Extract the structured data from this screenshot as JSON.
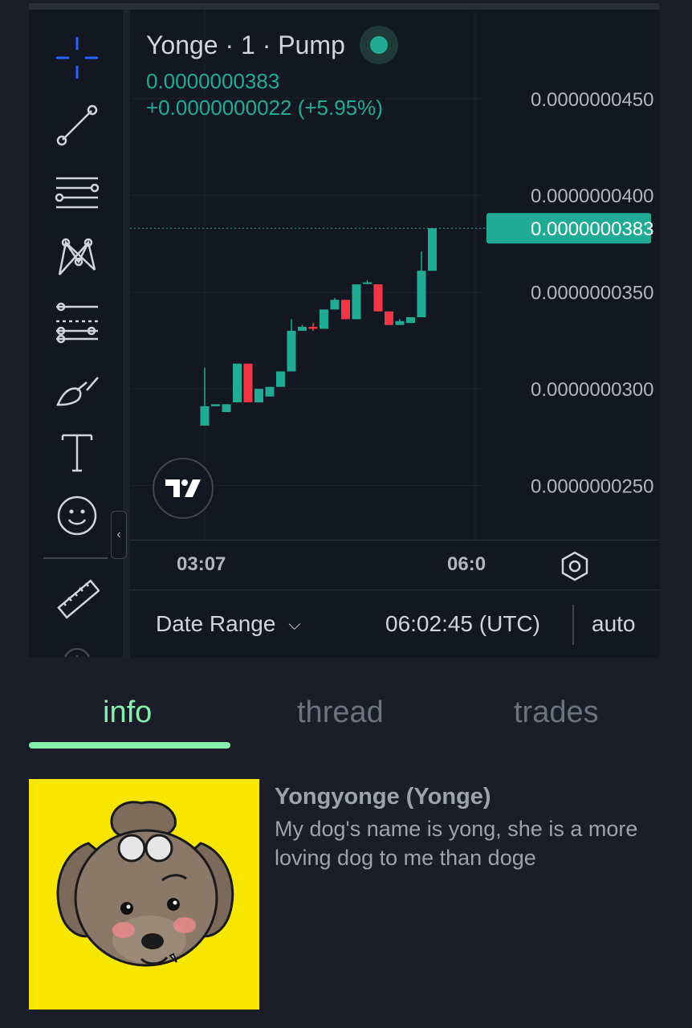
{
  "chart": {
    "title": "Yonge · 1 · Pump",
    "price": "0.0000000383",
    "change": "+0.0000000022 (+5.95%)",
    "current_price_label": "0.0000000383",
    "price_axis_labels": [
      "0.0000000450",
      "0.0000000400",
      "0.0000000350",
      "0.0000000300",
      "0.0000000250"
    ],
    "time_labels": [
      "03:07",
      "06:0"
    ],
    "colors": {
      "up": "#22ab94",
      "down": "#f23645",
      "background": "#131722"
    }
  },
  "chart_data": {
    "type": "candlestick",
    "title": "Yonge · 1 · Pump",
    "ylim": [
      2.22e-08,
      4.96e-08
    ],
    "price_ticks": [
      4.5e-08,
      4e-08,
      3.5e-08,
      3e-08,
      2.5e-08
    ],
    "x_ticks": [
      "03:07",
      "06:0"
    ],
    "last_price": 3.83e-08,
    "candles": [
      {
        "open": 2.81e-08,
        "high": 3.11e-08,
        "low": 2.81e-08,
        "close": 2.91e-08
      },
      {
        "open": 2.91e-08,
        "high": 2.92e-08,
        "low": 2.91e-08,
        "close": 2.92e-08
      },
      {
        "open": 2.88e-08,
        "high": 2.92e-08,
        "low": 2.88e-08,
        "close": 2.92e-08
      },
      {
        "open": 2.93e-08,
        "high": 3.13e-08,
        "low": 2.93e-08,
        "close": 3.13e-08
      },
      {
        "open": 3.13e-08,
        "high": 3.13e-08,
        "low": 2.93e-08,
        "close": 2.93e-08
      },
      {
        "open": 2.93e-08,
        "high": 3e-08,
        "low": 2.93e-08,
        "close": 3e-08
      },
      {
        "open": 2.96e-08,
        "high": 3.01e-08,
        "low": 2.96e-08,
        "close": 3.01e-08
      },
      {
        "open": 3.01e-08,
        "high": 3.09e-08,
        "low": 3.01e-08,
        "close": 3.09e-08
      },
      {
        "open": 3.09e-08,
        "high": 3.36e-08,
        "low": 3.09e-08,
        "close": 3.3e-08
      },
      {
        "open": 3.3e-08,
        "high": 3.33e-08,
        "low": 3.3e-08,
        "close": 3.32e-08
      },
      {
        "open": 3.32e-08,
        "high": 3.34e-08,
        "low": 3.3e-08,
        "close": 3.31e-08
      },
      {
        "open": 3.31e-08,
        "high": 3.41e-08,
        "low": 3.31e-08,
        "close": 3.41e-08
      },
      {
        "open": 3.41e-08,
        "high": 3.47e-08,
        "low": 3.41e-08,
        "close": 3.46e-08
      },
      {
        "open": 3.46e-08,
        "high": 3.46e-08,
        "low": 3.36e-08,
        "close": 3.36e-08
      },
      {
        "open": 3.36e-08,
        "high": 3.54e-08,
        "low": 3.36e-08,
        "close": 3.54e-08
      },
      {
        "open": 3.55e-08,
        "high": 3.56e-08,
        "low": 3.55e-08,
        "close": 3.55e-08
      },
      {
        "open": 3.54e-08,
        "high": 3.54e-08,
        "low": 3.4e-08,
        "close": 3.4e-08
      },
      {
        "open": 3.4e-08,
        "high": 3.4e-08,
        "low": 3.33e-08,
        "close": 3.33e-08
      },
      {
        "open": 3.33e-08,
        "high": 3.36e-08,
        "low": 3.33e-08,
        "close": 3.35e-08
      },
      {
        "open": 3.34e-08,
        "high": 3.37e-08,
        "low": 3.34e-08,
        "close": 3.37e-08
      },
      {
        "open": 3.37e-08,
        "high": 3.71e-08,
        "low": 3.37e-08,
        "close": 3.61e-08
      },
      {
        "open": 3.61e-08,
        "high": 3.83e-08,
        "low": 3.61e-08,
        "close": 3.83e-08
      }
    ]
  },
  "toolbar": {
    "tools": [
      "crosshair-icon",
      "trend-line-icon",
      "fib-retracement-icon",
      "pattern-icon",
      "forecast-icon",
      "brush-icon",
      "text-icon",
      "emoji-icon",
      "ruler-icon",
      "zoom-icon"
    ]
  },
  "footer": {
    "date_range": "Date Range",
    "clock": "06:02:45 (UTC)",
    "auto": "auto"
  },
  "tabs": {
    "info": "info",
    "thread": "thread",
    "trades": "trades",
    "active": "info"
  },
  "token": {
    "name": "Yongyonge (Yonge)",
    "description": "My dog's name is yong, she is a more loving dog to me than doge"
  }
}
